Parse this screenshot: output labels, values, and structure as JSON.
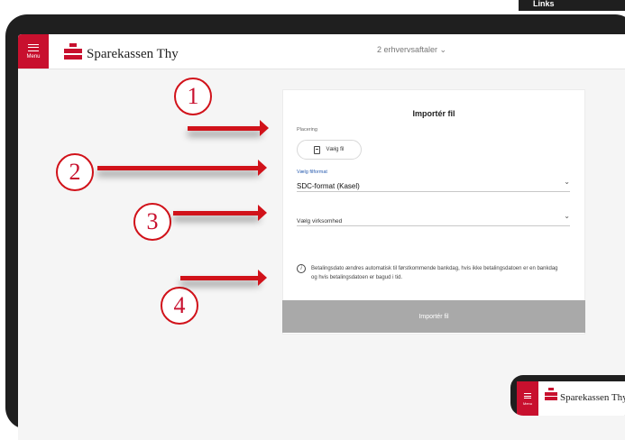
{
  "top_tab": {
    "label": "Links"
  },
  "header": {
    "menu_label": "Menu",
    "brand": "Sparekassen Thy",
    "agreements": "2 erhvervsaftaler ⌄"
  },
  "import_card": {
    "title": "Importér fil",
    "location_label": "Placering",
    "choose_file_label": "Vælg fil",
    "format_label": "Vælg filformat",
    "format_value": "SDC-format (Kasel)",
    "company_placeholder": "Vælg virksomhed",
    "info_text": "Betalingsdato ændres automatisk til førstkommende bankdag, hvis ikke betalingsdatoen er en bankdag og hvis betalingsdatoen er bagud i tid.",
    "import_button": "Importér fil"
  },
  "annotations": [
    "1",
    "2",
    "3",
    "4"
  ],
  "mini_preview": {
    "menu_label": "Menu",
    "brand": "Sparekassen Thy"
  },
  "colors": {
    "brand_red": "#c8102e",
    "button_gray": "#a9a9a9"
  }
}
